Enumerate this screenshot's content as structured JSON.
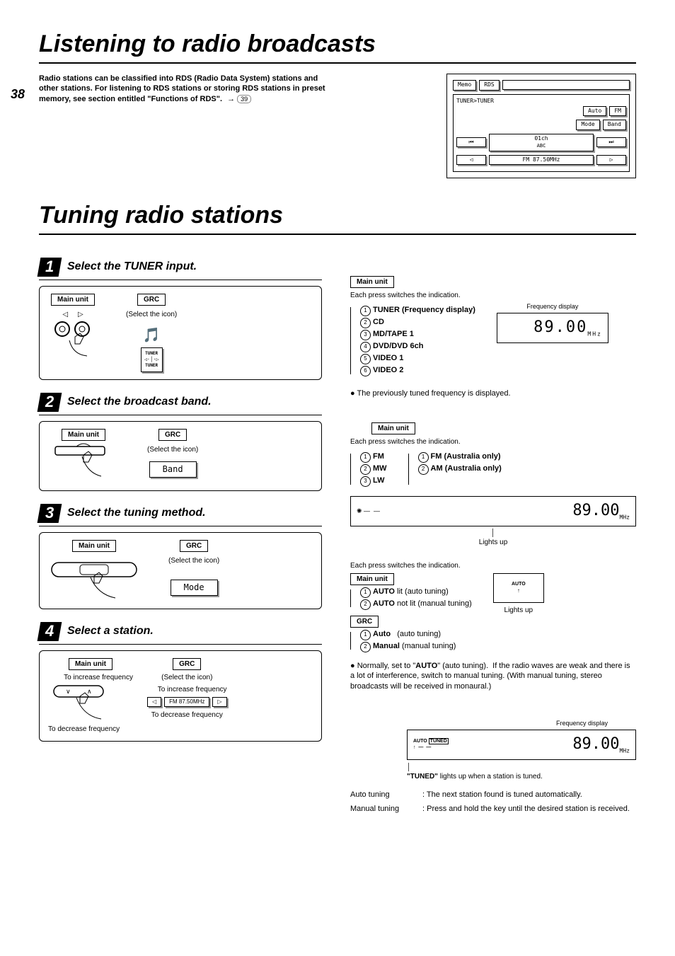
{
  "page_number": "38",
  "main_title": "Listening to radio broadcasts",
  "intro_text": "Radio stations can be classified into RDS (Radio Data System) stations and other stations. For listening to RDS stations or storing RDS stations in preset memory, see section entitled \"Functions of RDS\".",
  "ref_page": "39",
  "screen": {
    "top_buttons": [
      "Memo",
      "RDS"
    ],
    "breadcrumb": "TUNER>TUNER",
    "mode_buttons": [
      "Auto",
      "FM",
      "Mode",
      "Band"
    ],
    "channel": "01ch",
    "channel_sub": "ABC",
    "freq": "FM 87.50MHz"
  },
  "sub_title": "Tuning radio stations",
  "steps": [
    {
      "num": "1",
      "title": "Select the TUNER input."
    },
    {
      "num": "2",
      "title": "Select the broadcast band."
    },
    {
      "num": "3",
      "title": "Select the tuning method."
    },
    {
      "num": "4",
      "title": "Select a station."
    }
  ],
  "labels": {
    "main_unit": "Main unit",
    "grc": "GRC",
    "select_icon": "(Select the icon)"
  },
  "icons": {
    "tuner_icon_line1": "TUNER",
    "tuner_icon_line2": "TUNER",
    "band_btn": "Band",
    "mode_btn": "Mode"
  },
  "right1": {
    "caption": "Each press switches the indication.",
    "items": [
      "TUNER (Frequency display)",
      "CD",
      "MD/TAPE 1",
      "DVD/DVD 6ch",
      "VIDEO 1",
      "VIDEO 2"
    ],
    "freq_label": "Frequency display",
    "freq_value": "89.00",
    "freq_unit": "MHz",
    "bullet": "The previously tuned frequency is displayed."
  },
  "right2": {
    "caption": "Each press switches the indication.",
    "left_items": [
      "FM",
      "MW",
      "LW"
    ],
    "right_items": [
      "FM (Australia only)",
      "AM (Australia only)"
    ],
    "freq_value": "89.00",
    "freq_unit": "MHz",
    "lights_up": "Lights up"
  },
  "right3": {
    "caption": "Each press switches the indication.",
    "mu_items": [
      "AUTO lit (auto tuning)",
      "AUTO not lit (manual tuning)"
    ],
    "grc_items": [
      {
        "k": "Auto",
        "v": "(auto tuning)"
      },
      {
        "k": "Manual",
        "v": "(manual tuning)"
      }
    ],
    "lights_up": "Lights up",
    "auto_label": "AUTO",
    "bullet": "Normally, set to \"AUTO\" (auto tuning).  If the radio waves are weak and there is a lot of interference, switch to manual tuning. (With manual tuning, stereo broadcasts will be received in monaural.)"
  },
  "step4_panel": {
    "inc_freq": "To increase frequency",
    "dec_freq": "To decrease frequency",
    "freq_btn": "FM 87.50MHz"
  },
  "right4": {
    "freq_label": "Frequency display",
    "auto": "AUTO",
    "tuned": "TUNED",
    "freq_value": "89.00",
    "freq_unit": "MHz",
    "tuned_caption": "\"TUNED\" lights up when a station is tuned.",
    "rows": [
      {
        "k": "Auto tuning",
        "v": ": The next station found is tuned automatically."
      },
      {
        "k": "Manual tuning",
        "v": ": Press and hold the key until the desired station is received."
      }
    ]
  }
}
